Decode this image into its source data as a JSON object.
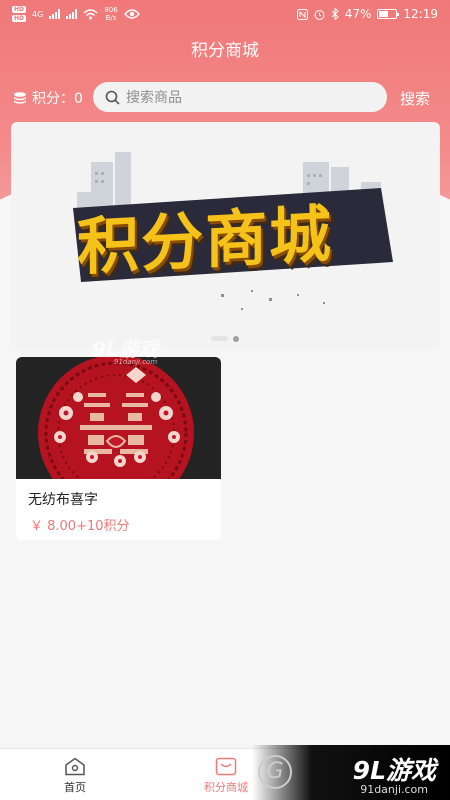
{
  "status_bar": {
    "sim1": "HD",
    "sim2": "HD",
    "network": "4G",
    "speed_value": "806",
    "speed_unit": "B/s",
    "battery": "47%",
    "time": "12:19"
  },
  "header": {
    "title": "积分商城"
  },
  "points": {
    "label": "积分：0"
  },
  "search": {
    "placeholder": "搜索商品",
    "button_label": "搜索"
  },
  "banner": {
    "text": "积分商城",
    "slide_count": 2,
    "active_slide": 2
  },
  "products": [
    {
      "name": "无纺布喜字",
      "price": "￥ 8.00+10积分",
      "image_icon": "double-happiness-image"
    }
  ],
  "watermark": {
    "text": "9L游戏",
    "url": "91danji.com"
  },
  "tabbar": {
    "items": [
      {
        "label": "首页",
        "icon": "home-icon",
        "active": false
      },
      {
        "label": "积分商城",
        "icon": "mall-icon",
        "active": true
      }
    ]
  },
  "brand_badge": {
    "logo": "9L游戏",
    "url": "91danji.com",
    "ring_letter": "G"
  },
  "colors": {
    "accent": "#f07878",
    "background": "#f6f6f6",
    "banner_text": "#f5c21a"
  }
}
